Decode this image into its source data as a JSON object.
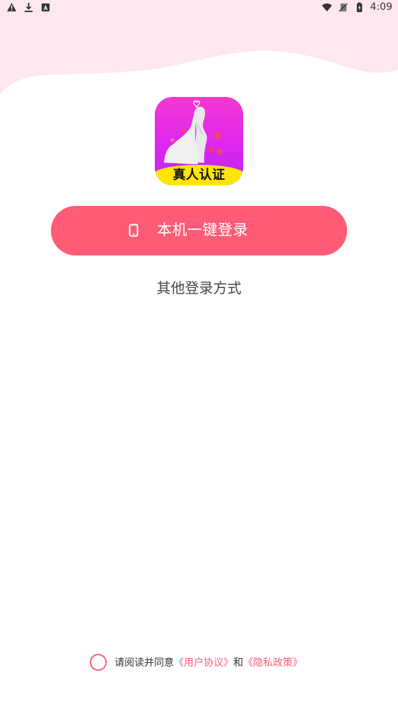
{
  "status_bar": {
    "time": "4:09"
  },
  "logo": {
    "badge_text": "真人认证"
  },
  "login": {
    "primary_label": "本机一键登录",
    "other_label": "其他登录方式"
  },
  "agreement": {
    "prefix": "请阅读并同意",
    "user_agreement": "《用户协议》",
    "conjunction": "和",
    "privacy_policy": "《隐私政策》"
  },
  "colors": {
    "accent": "#ff5b76",
    "logo_gradient_top": "#f338d0",
    "logo_gradient_bottom": "#b926f4",
    "badge": "#ffe500",
    "wave": "#fde8ee"
  },
  "icons": {
    "status_left": [
      "warning-icon",
      "download-icon",
      "font-icon"
    ],
    "status_right": [
      "wifi-icon",
      "no-sim-icon",
      "battery-icon"
    ],
    "login": "phone-icon",
    "agreement": "radio-icon"
  }
}
